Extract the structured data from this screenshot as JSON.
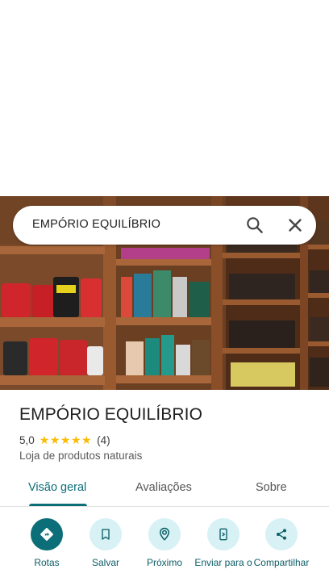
{
  "search": {
    "query": "EMPÓRIO EQUILÍBRIO"
  },
  "place": {
    "name": "EMPÓRIO EQUILÍBRIO",
    "rating": "5,0",
    "stars": 5,
    "review_count": "(4)",
    "category": "Loja de produtos naturais"
  },
  "tabs": [
    {
      "label": "Visão geral",
      "active": true
    },
    {
      "label": "Avaliações",
      "active": false
    },
    {
      "label": "Sobre",
      "active": false
    }
  ],
  "actions": [
    {
      "label": "Rotas",
      "icon": "directions-icon"
    },
    {
      "label": "Salvar",
      "icon": "bookmark-icon"
    },
    {
      "label": "Próximo",
      "icon": "nearby-icon"
    },
    {
      "label": "Enviar para o",
      "icon": "send-to-phone-icon"
    },
    {
      "label": "Compartilhar",
      "icon": "share-icon"
    }
  ],
  "colors": {
    "accent": "#0b6e78",
    "action_bg": "#d7f1f5",
    "star": "#fbbc04"
  }
}
